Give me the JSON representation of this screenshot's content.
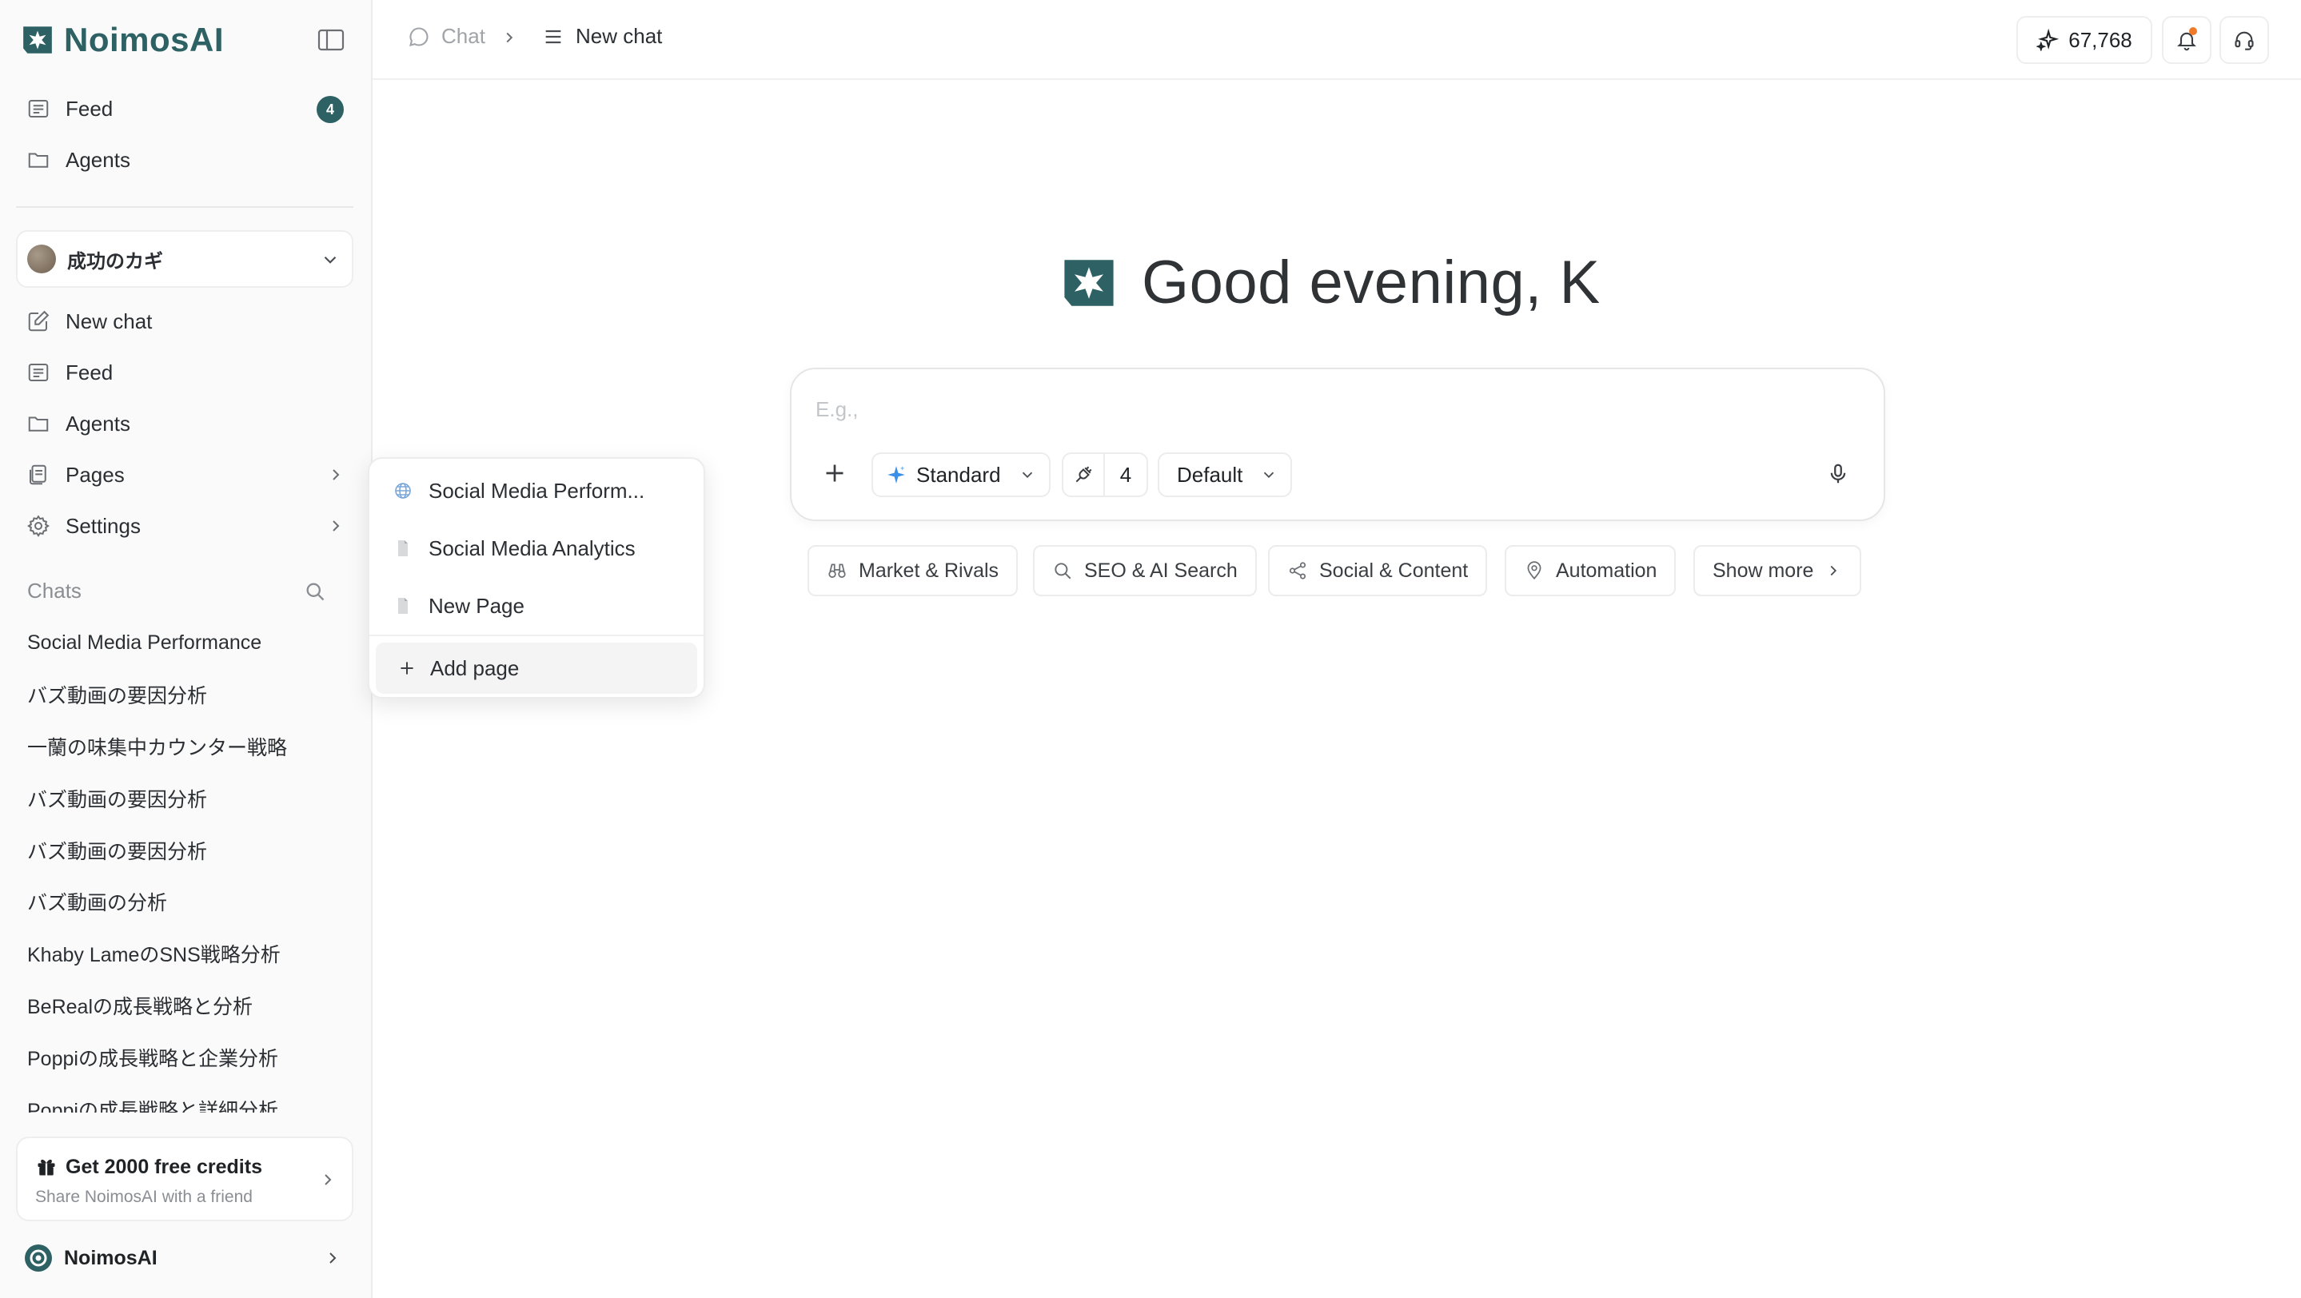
{
  "app": {
    "name": "NoimosAI"
  },
  "sidebar": {
    "top_items": [
      {
        "label": "Feed",
        "icon": "list-icon",
        "badge": "4"
      },
      {
        "label": "Agents",
        "icon": "folder-icon"
      }
    ],
    "workspace": {
      "name": "成功のカギ"
    },
    "items": [
      {
        "label": "New chat",
        "icon": "edit-icon"
      },
      {
        "label": "Feed",
        "icon": "list-icon"
      },
      {
        "label": "Agents",
        "icon": "folder-icon"
      },
      {
        "label": "Pages",
        "icon": "pages-icon"
      },
      {
        "label": "Settings",
        "icon": "gear-icon"
      }
    ],
    "chats_header": "Chats",
    "chats": [
      "Social Media Performance",
      "バズ動画の要因分析",
      "一蘭の味集中カウンター戦略",
      "バズ動画の要因分析",
      "バズ動画の要因分析",
      "バズ動画の分析",
      "Khaby LameのSNS戦略分析",
      "BeRealの成長戦略と分析",
      "Poppiの成長戦略と企業分析",
      "Poppiの成長戦略と詳細分析"
    ],
    "promo": {
      "title": "Get 2000 free credits",
      "subtitle": "Share NoimosAI with a friend"
    },
    "account": {
      "name": "NoimosAI"
    }
  },
  "topbar": {
    "breadcrumb_root": "Chat",
    "breadcrumb_current": "New chat",
    "credits": "67,768"
  },
  "main": {
    "greeting": "Good evening, K",
    "composer": {
      "placeholder": "E.g.,",
      "mode": "Standard",
      "tools_count": "4",
      "model": "Default"
    },
    "chips": [
      "Market & Rivals",
      "SEO & AI Search",
      "Social & Content",
      "Automation",
      "Show more"
    ]
  },
  "pages_popover": {
    "items": [
      "Social Media Perform...",
      "Social Media Analytics",
      "New Page"
    ],
    "add_label": "Add page"
  },
  "colors": {
    "brand": "#2d6164",
    "notification": "#f07a2a",
    "sparkle": "#3b8fe8"
  }
}
